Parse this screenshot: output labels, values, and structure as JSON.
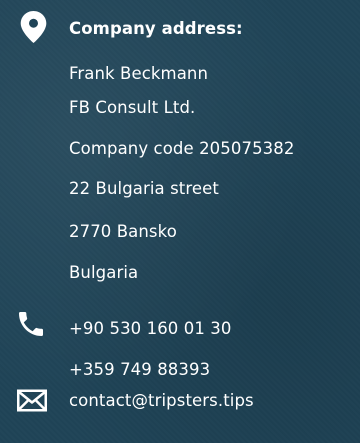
{
  "address": {
    "icon": "map-pin-icon",
    "heading": "Company address:",
    "lines": [
      "Frank Beckmann",
      "FB Consult Ltd.",
      "Company code 205075382",
      "22 Bulgaria street",
      "2770 Bansko",
      "Bulgaria"
    ]
  },
  "phone": {
    "icon": "phone-icon",
    "numbers": [
      "+90 530 160 01 30",
      "+359 749 88393"
    ]
  },
  "email": {
    "icon": "envelope-icon",
    "address": "contact@tripsters.tips"
  },
  "colors": {
    "background": "#1f4457",
    "text": "#ffffff"
  }
}
